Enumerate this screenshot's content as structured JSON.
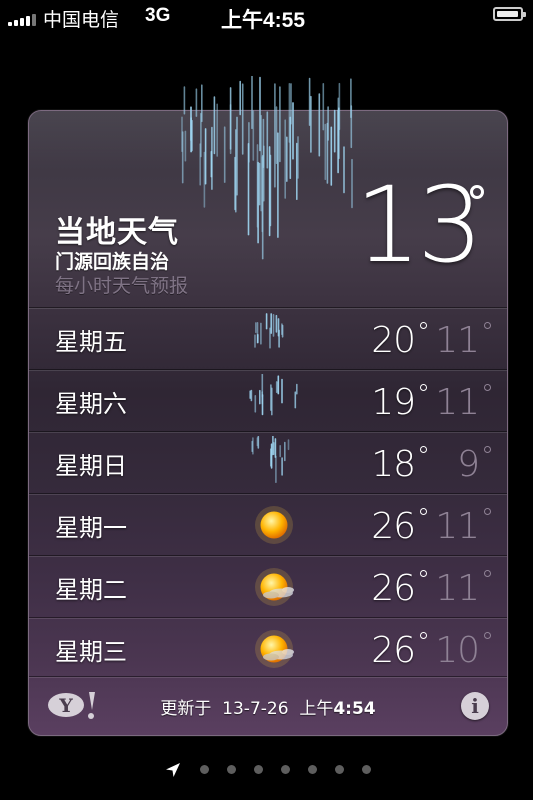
{
  "status_bar": {
    "carrier": "中国电信",
    "network": "3G",
    "time": "上午4:55",
    "battery_level": 0.95
  },
  "weather": {
    "title": "当地天气",
    "location": "门源回族自治",
    "hourly_link": "每小时天气预报",
    "current_temp": "13",
    "current_condition_icon": "rain-icon",
    "forecast": [
      {
        "day": "星期五",
        "icon": "rain-icon",
        "high": "20",
        "low": "11"
      },
      {
        "day": "星期六",
        "icon": "rain-icon",
        "high": "19",
        "low": "11"
      },
      {
        "day": "星期日",
        "icon": "rain-icon",
        "high": "18",
        "low": "9"
      },
      {
        "day": "星期一",
        "icon": "sun-icon",
        "high": "26",
        "low": "11"
      },
      {
        "day": "星期二",
        "icon": "sun-cloud-icon",
        "high": "26",
        "low": "11"
      },
      {
        "day": "星期三",
        "icon": "sun-cloud-icon",
        "high": "26",
        "low": "10"
      }
    ],
    "footer": {
      "updated_label": "更新于",
      "updated_date": "13-7-26",
      "updated_ampm": "上午",
      "updated_time": "4:54",
      "logo": "yahoo-logo",
      "info_icon": "info-icon"
    }
  },
  "pager": {
    "page_count": 7,
    "current_page": "location"
  },
  "colors": {
    "card_top": "#3a3540",
    "card_bottom": "#5a3f60",
    "low_temp": "#8f8295",
    "rain": "#9fd6f2",
    "sun": "#ffb400"
  }
}
